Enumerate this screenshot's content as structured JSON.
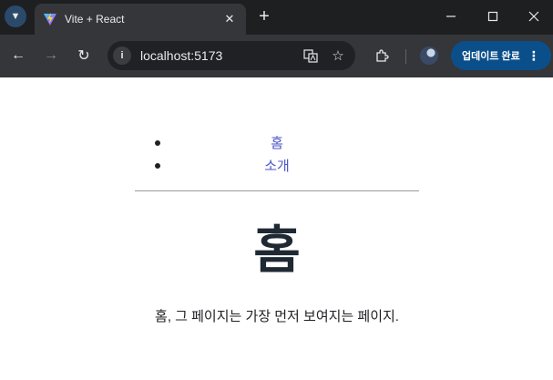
{
  "browser": {
    "tab": {
      "title": "Vite + React",
      "favicon": "vite-logo-icon"
    },
    "window_controls": [
      "minimize-icon",
      "maximize-icon",
      "close-icon"
    ],
    "address_bar": {
      "url": "localhost:5173"
    },
    "update_button": {
      "label": "업데이트 완료"
    },
    "colors": {
      "tab_bar": "#1e1f20",
      "toolbar": "#35363a",
      "update_pill": "#0b4f8a"
    }
  },
  "page": {
    "nav": [
      {
        "label": "홈"
      },
      {
        "label": "소개"
      }
    ],
    "title": "홈",
    "description": "홈, 그 페이지는 가장 먼저 보여지는 페이지.",
    "colors": {
      "link": "#4b55c9",
      "heading": "#1f2933"
    }
  }
}
